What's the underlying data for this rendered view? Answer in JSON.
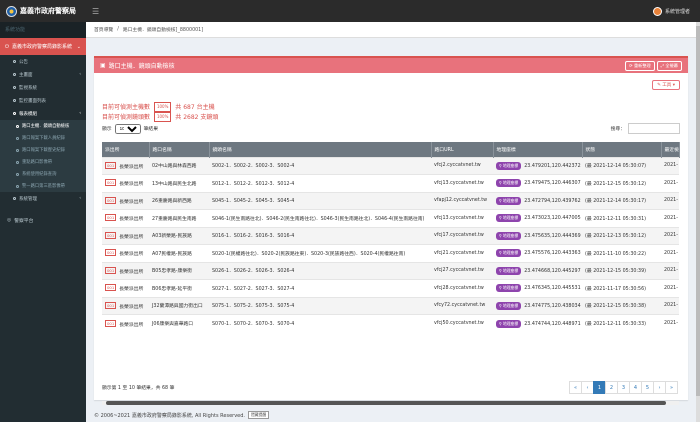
{
  "topbar": {
    "title": "嘉義市政府警察局",
    "user_name": "系統管理者"
  },
  "sidebar": {
    "header": "系統功能",
    "main_item": "嘉義市政府警察局錄影系統",
    "items": [
      {
        "label": "公告",
        "active": false
      },
      {
        "label": "主畫面",
        "active": false,
        "has_children": true
      },
      {
        "label": "監視系統",
        "active": false
      },
      {
        "label": "監控畫面列表",
        "active": false
      },
      {
        "label": "報表模組",
        "active": true,
        "has_children": true
      }
    ],
    "sub_items": [
      {
        "label": "路口主機．鏡頭自動檢核",
        "active": true
      },
      {
        "label": "路口報案下載人員紀錄",
        "active": false
      },
      {
        "label": "路口報案下載歷史紀錄",
        "active": false
      },
      {
        "label": "重點路口影像帶",
        "active": false
      },
      {
        "label": "系統使用紀錄查詢",
        "active": false
      },
      {
        "label": "警一路口第三區影像帶",
        "active": false
      }
    ],
    "after_items": [
      {
        "label": "系統管理",
        "has_children": true
      }
    ],
    "platform": "警察平台"
  },
  "breadcrumb": {
    "home": "首頁導覽",
    "current": "路口主機．鏡頭自動檢核[_8800001]"
  },
  "box": {
    "title": "路口主機．鏡頭自動檢核",
    "btn_refresh": "重新整理",
    "btn_fullscreen": "全螢幕",
    "tools": "工具"
  },
  "stats": {
    "line1_prefix": "目前可偵測主機數",
    "line1_pct": "100%",
    "line1_suffix": "共 687 台主機",
    "line2_prefix": "目前可偵測鏡頭數",
    "line2_pct": "100%",
    "line2_suffix": "共 2682 支鏡頭"
  },
  "controls": {
    "show_label": "顯示",
    "page_size": "10",
    "entries_label": "筆結果",
    "search_label": "搜尋："
  },
  "table": {
    "columns": [
      "派出所",
      "路口名稱",
      "鏡頭名稱",
      "路口URL",
      "地理座標",
      "狀態",
      "最近檢"
    ],
    "rows": [
      {
        "btn": "001",
        "station": "長榮派出所",
        "name": "02中山路與林森西路",
        "cams": "S002-1．S002-2．S002-3．S002-4",
        "url": "vfcj2.cyccatvnet.tw",
        "map": "地理座標",
        "coords": "23.479201,120.442372",
        "date": "(最 2021-12-14 05:30:07)",
        "last": "2021-"
      },
      {
        "btn": "001",
        "station": "長榮派出所",
        "name": "13中山路與民生北路",
        "cams": "S012-1．S012-2．S012-3．S012-4",
        "url": "vfcj13.cyccatvnet.tw",
        "map": "地理座標",
        "coords": "23.479475,120.446307",
        "date": "(最 2021-12-15 05:30:12)",
        "last": "2021-"
      },
      {
        "btn": "001",
        "station": "長榮派出所",
        "name": "26重慶路與新西路",
        "cams": "S045-1．S045-2．S045-3．S045-4",
        "url": "vfapj12.cyccatvnet.tw",
        "map": "地理座標",
        "coords": "23.472794,120.439762",
        "date": "(最 2021-12-14 05:30:17)",
        "last": "2021-"
      },
      {
        "btn": "001",
        "station": "長榮派出所",
        "name": "27重慶路與民生南路",
        "cams": "S046-1(民生南路往北)．S046-2(民生南路往北)．S046-3(民生南路往北)．S046-4(民生南路往南)",
        "url": "vfcj13.cyccatvnet.tw",
        "map": "地理座標",
        "coords": "23.473023,120.447005",
        "date": "(最 2021-12-11 05:30:31)",
        "last": "2021-"
      },
      {
        "btn": "001",
        "station": "長榮派出所",
        "name": "A03新榮路-民族路",
        "cams": "S016-1．S016-2．S016-3．S016-4",
        "url": "vfcj17.cyccatvnet.tw",
        "map": "地理座標",
        "coords": "23.475635,120.444369",
        "date": "(最 2021-12-13 05:30:12)",
        "last": "2021-"
      },
      {
        "btn": "001",
        "station": "長榮派出所",
        "name": "A07民權路-民族路",
        "cams": "S020-1(民權路往北)．S020-2(民族路往東)．S020-3(民族路往西)．S020-4(民權路往南)",
        "url": "vfcj21.cyccatvnet.tw",
        "map": "地理座標",
        "coords": "23.475576,120.443363",
        "date": "(最 2021-11-10 05:30:22)",
        "last": "2021-"
      },
      {
        "btn": "001",
        "station": "長榮派出所",
        "name": "B05忠孝路-康樂街",
        "cams": "S026-1．S026-2．S026-3．S026-4",
        "url": "vfcj27.cyccatvnet.tw",
        "map": "地理座標",
        "coords": "23.474668,120.445297",
        "date": "(最 2021-12-15 05:30:39)",
        "last": "2021-"
      },
      {
        "btn": "001",
        "station": "長榮派出所",
        "name": "B06忠孝路-延平街",
        "cams": "S027-1．S027-2．S027-3．S027-4",
        "url": "vfcj28.cyccatvnet.tw",
        "map": "地理座標",
        "coords": "23.476345,120.445531",
        "date": "(最 2021-11-17 05:30:56)",
        "last": "2021-"
      },
      {
        "btn": "001",
        "station": "長榮派出所",
        "name": "J32蘭潭路與國力街出口",
        "cams": "S075-1．S075-2．S075-3．S075-4",
        "url": "vfcy72.cyccatvnet.tw",
        "map": "地理座標",
        "coords": "23.474775,120.438034",
        "date": "(最 2021-12-15 05:30:38)",
        "last": "2021-"
      },
      {
        "btn": "001",
        "station": "長榮派出所",
        "name": "J06康樂與嘉華路口",
        "cams": "S070-1．S070-2．S070-3．S070-4",
        "url": "vfcj50.cyccatvnet.tw",
        "map": "地理座標",
        "coords": "23.474744,120.448971",
        "date": "(最 2021-12-11 05:30:33)",
        "last": "2021-"
      }
    ]
  },
  "footer_info": "顯示第 1 至 10 筆結果，共 68 筆",
  "pagination": [
    "«",
    "‹",
    "1",
    "2",
    "3",
    "4",
    "5",
    "›",
    "»"
  ],
  "pagination_active": "1",
  "footer": {
    "text": "© 2006~2021 嘉義市政府警察局錄影系統, All Rights Reserved.",
    "btn": "隱藏提醒"
  }
}
